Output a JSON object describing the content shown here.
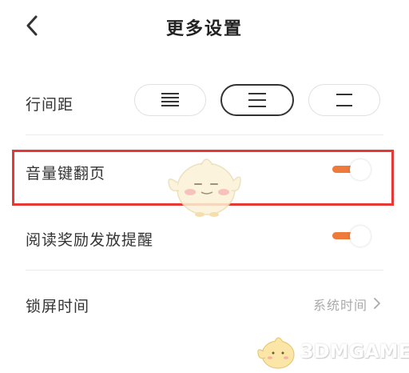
{
  "header": {
    "title": "更多设置",
    "back_icon": "chevron-left-icon"
  },
  "line_spacing": {
    "label": "行间距",
    "options": [
      {
        "icon": "spacing-tight-icon",
        "selected": false
      },
      {
        "icon": "spacing-medium-icon",
        "selected": true
      },
      {
        "icon": "spacing-loose-icon",
        "selected": false
      }
    ]
  },
  "volume_page_turn": {
    "label": "音量键翻页",
    "toggle_on": true
  },
  "reading_reward_reminder": {
    "label": "阅读奖励发放提醒",
    "toggle_on": true
  },
  "lock_screen_time": {
    "label": "锁屏时间",
    "value": "系统时间",
    "chevron_icon": "chevron-right-icon"
  },
  "watermark": {
    "text": "3DMGAME"
  },
  "colors": {
    "accent": "#ee7a3b",
    "highlight": "#e53935",
    "text_primary": "#333333",
    "text_secondary": "#aaaaaa"
  }
}
